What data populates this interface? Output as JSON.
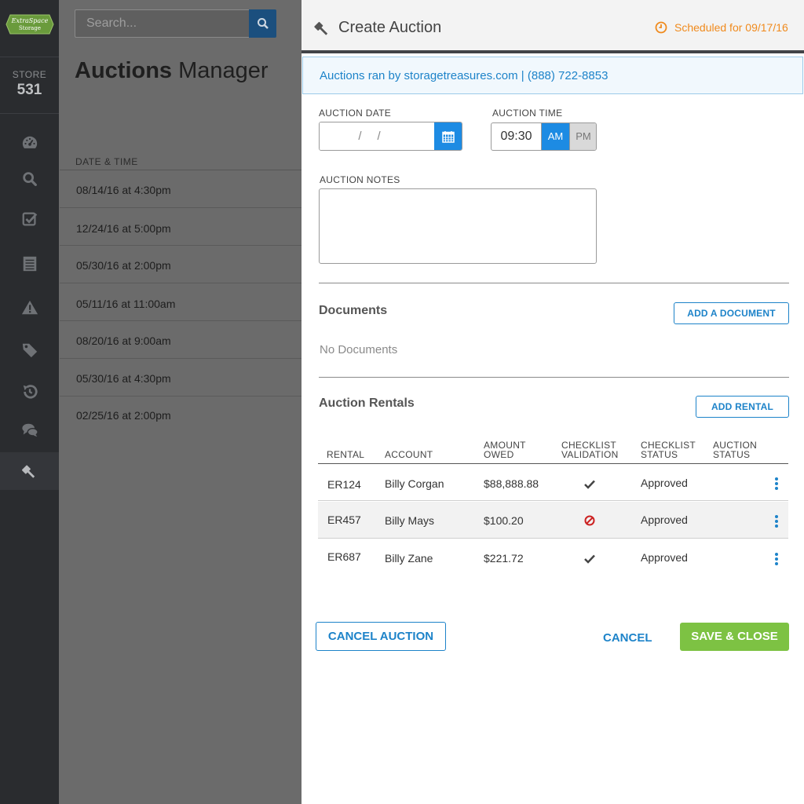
{
  "app": {
    "logo_text_line1": "ExtraSpace",
    "logo_text_line2": "Storage",
    "logo_color": "#6a9b3c"
  },
  "sidebar": {
    "store_label": "STORE",
    "store_number": "531",
    "items": [
      {
        "icon": "dashboard-icon",
        "active": false
      },
      {
        "icon": "search-icon",
        "active": false
      },
      {
        "icon": "checklist-icon",
        "active": false
      },
      {
        "icon": "ledger-icon",
        "active": false
      },
      {
        "icon": "warning-icon",
        "active": false
      },
      {
        "icon": "tag-icon",
        "active": false
      },
      {
        "icon": "history-icon",
        "active": false
      },
      {
        "icon": "chat-icon",
        "active": false
      },
      {
        "icon": "gavel-icon",
        "active": true
      }
    ]
  },
  "search": {
    "placeholder": "Search..."
  },
  "page": {
    "title_bold": "Auctions",
    "title_rest": "Manager",
    "column_header": "DATE & TIME",
    "rows": [
      "08/14/16 at 4:30pm",
      "12/24/16 at 5:00pm",
      "05/30/16 at 2:00pm",
      "05/11/16 at 11:00am",
      "08/20/16 at 9:00am",
      "05/30/16 at 4:30pm",
      "02/25/16 at 2:00pm"
    ]
  },
  "modal": {
    "title": "Create Auction",
    "scheduled": "Scheduled for 09/17/16",
    "banner": "Auctions ran by storagetreasures.com | (888) 722-8853",
    "date_label": "AUCTION DATE",
    "date_value": "//",
    "time_label": "AUCTION TIME",
    "time_value": "09:30",
    "am_label": "AM",
    "pm_label": "PM",
    "selected_period": "AM",
    "notes_label": "AUCTION NOTES",
    "notes_value": "",
    "documents_title": "Documents",
    "add_document_label": "ADD A DOCUMENT",
    "no_documents": "No Documents",
    "rentals_title": "Auction Rentals",
    "add_rental_label": "ADD RENTAL",
    "columns": {
      "rental": "RENTAL",
      "account": "ACCOUNT",
      "amount_1": "AMOUNT",
      "amount_2": "OWED",
      "validation_1": "CHECKLIST",
      "validation_2": "VALIDATION",
      "status_1": "CHECKLIST",
      "status_2": "STATUS",
      "auction_status_1": "AUCTION",
      "auction_status_2": "STATUS"
    },
    "rentals": [
      {
        "rental": "ER124",
        "account": "Billy Corgan",
        "amount": "$88,888.88",
        "validation": "check-icon",
        "status": "Approved"
      },
      {
        "rental": "ER457",
        "account": "Billy Mays",
        "amount": "$100.20",
        "validation": "blocked-icon",
        "status": "Approved"
      },
      {
        "rental": "ER687",
        "account": "Billy Zane",
        "amount": "$221.72",
        "validation": "check-icon",
        "status": "Approved"
      }
    ],
    "cancel_auction_label": "CANCEL AUCTION",
    "cancel_label": "CANCEL",
    "save_close_label": "SAVE & CLOSE"
  },
  "colors": {
    "accent": "#1d83c9",
    "primary_button": "#1d8be3",
    "save_button": "#7dc243",
    "scheduled": "#f08a1c",
    "blocked": "#cc2222"
  }
}
